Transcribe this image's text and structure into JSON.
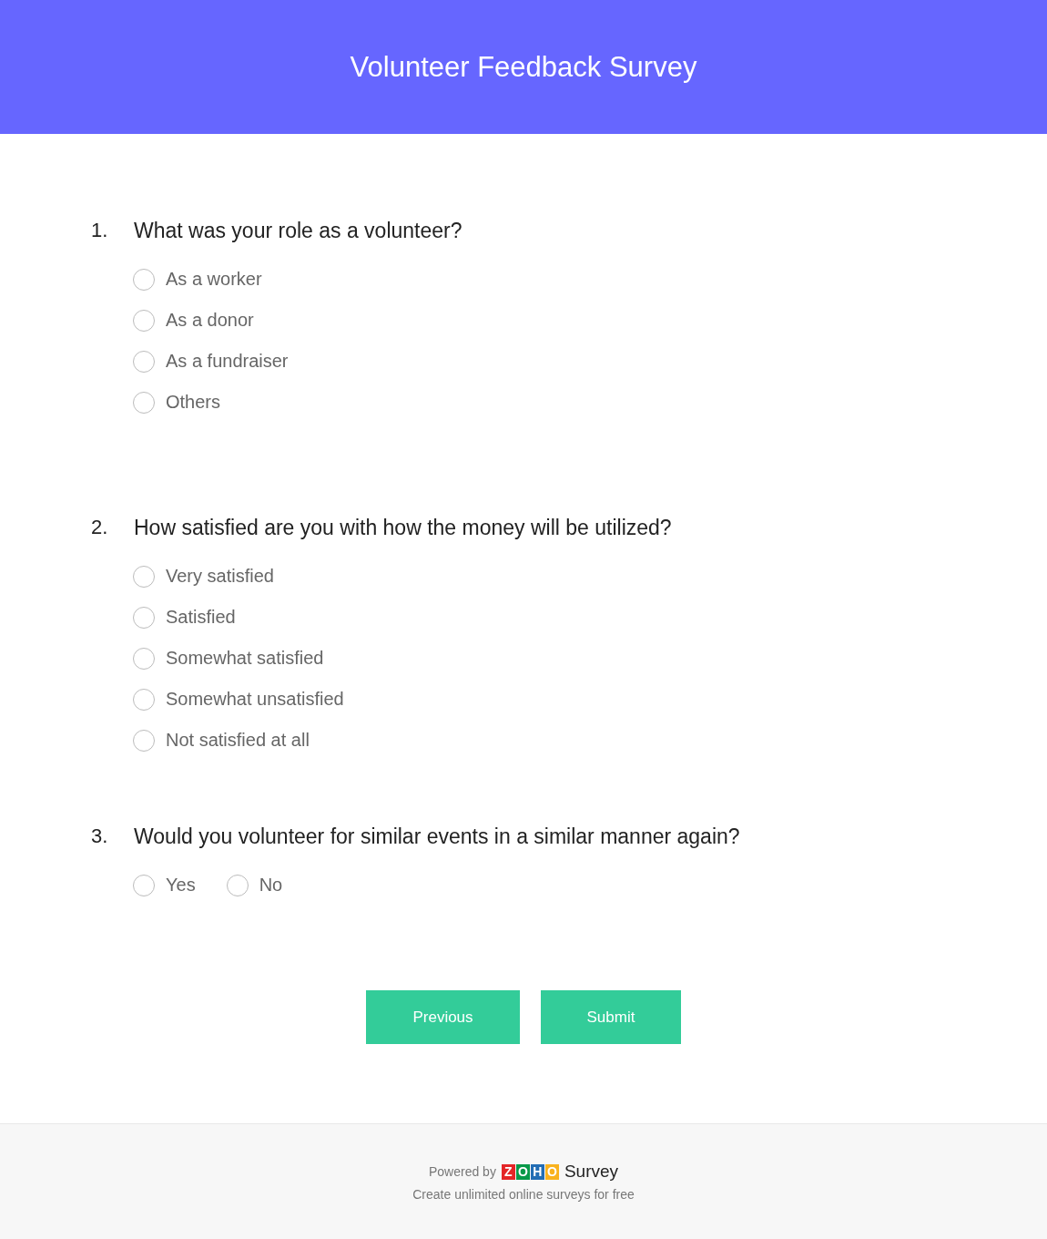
{
  "header": {
    "title": "Volunteer Feedback Survey"
  },
  "questions": [
    {
      "number": "1.",
      "text": "What was your role as a volunteer?",
      "kind": "list",
      "options": [
        {
          "label": "As a worker",
          "selected": false
        },
        {
          "label": "As a donor",
          "selected": false
        },
        {
          "label": "As a fundraiser",
          "selected": false
        },
        {
          "label": "Others",
          "selected": false
        }
      ]
    },
    {
      "number": "2.",
      "text": "How satisfied are you with how the money will be utilized?",
      "kind": "list",
      "options": [
        {
          "label": "Very satisfied",
          "selected": false
        },
        {
          "label": "Satisfied",
          "selected": false
        },
        {
          "label": "Somewhat satisfied",
          "selected": false
        },
        {
          "label": "Somewhat unsatisfied",
          "selected": false
        },
        {
          "label": "Not satisfied at all",
          "selected": false
        }
      ]
    },
    {
      "number": "3.",
      "text": "Would you volunteer for similar events in a similar manner again?",
      "kind": "inline",
      "options": [
        {
          "label": "Yes",
          "selected": false
        },
        {
          "label": "No",
          "selected": false
        }
      ]
    }
  ],
  "buttons": [
    "Previous",
    "Submit"
  ],
  "footer": {
    "powered_by": "Powered by",
    "logo_letters": [
      {
        "letter": "Z",
        "color": "#e42527"
      },
      {
        "letter": "O",
        "color": "#089949"
      },
      {
        "letter": "H",
        "color": "#226db4"
      },
      {
        "letter": "O",
        "color": "#f9b21d"
      }
    ],
    "product": "Survey",
    "tagline": "Create unlimited online surveys for free"
  }
}
